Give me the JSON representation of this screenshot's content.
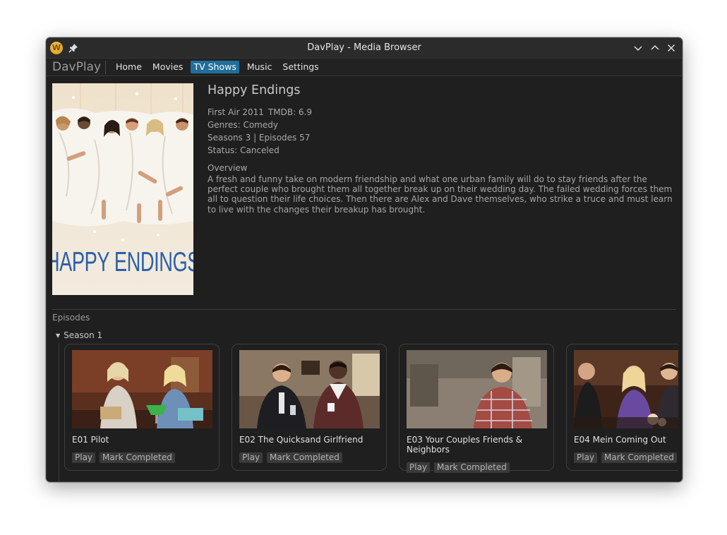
{
  "window": {
    "title": "DavPlay - Media Browser",
    "app_icon_letter": "W"
  },
  "nav": {
    "brand": "DavPlay",
    "items": [
      {
        "label": "Home",
        "active": false
      },
      {
        "label": "Movies",
        "active": false
      },
      {
        "label": "TV Shows",
        "active": true
      },
      {
        "label": "Music",
        "active": false
      },
      {
        "label": "Settings",
        "active": false
      }
    ]
  },
  "show": {
    "poster_title": "HAPPY ENDINGS",
    "title": "Happy Endings",
    "first_air": "First Air 2011",
    "tmdb": "TMDB: 6.9",
    "genres": "Genres: Comedy",
    "seasons_episodes": "Seasons 3 | Episodes 57",
    "status": "Status: Canceled",
    "overview_label": "Overview",
    "overview": "A fresh and funny take on modern friendship and what one urban family will do to stay friends after the perfect couple who brought them all together break up on their wedding day. The failed wedding forces them all to question their life choices. Then there are Alex and Dave themselves, who strike a truce and must learn to live with the changes their breakup has brought."
  },
  "episodes": {
    "label": "Episodes",
    "season_label": "Season 1",
    "play_label": "Play",
    "mark_label": "Mark Completed",
    "items": [
      {
        "title": "E01 Pilot"
      },
      {
        "title": "E02 The Quicksand Girlfriend"
      },
      {
        "title": "E03 Your Couples Friends & Neighbors"
      },
      {
        "title": "E04 Mein Coming Out"
      }
    ]
  },
  "colors": {
    "accent": "#1f6f9a",
    "background": "#1f1f1f",
    "poster_text": "#2b5fa8"
  }
}
